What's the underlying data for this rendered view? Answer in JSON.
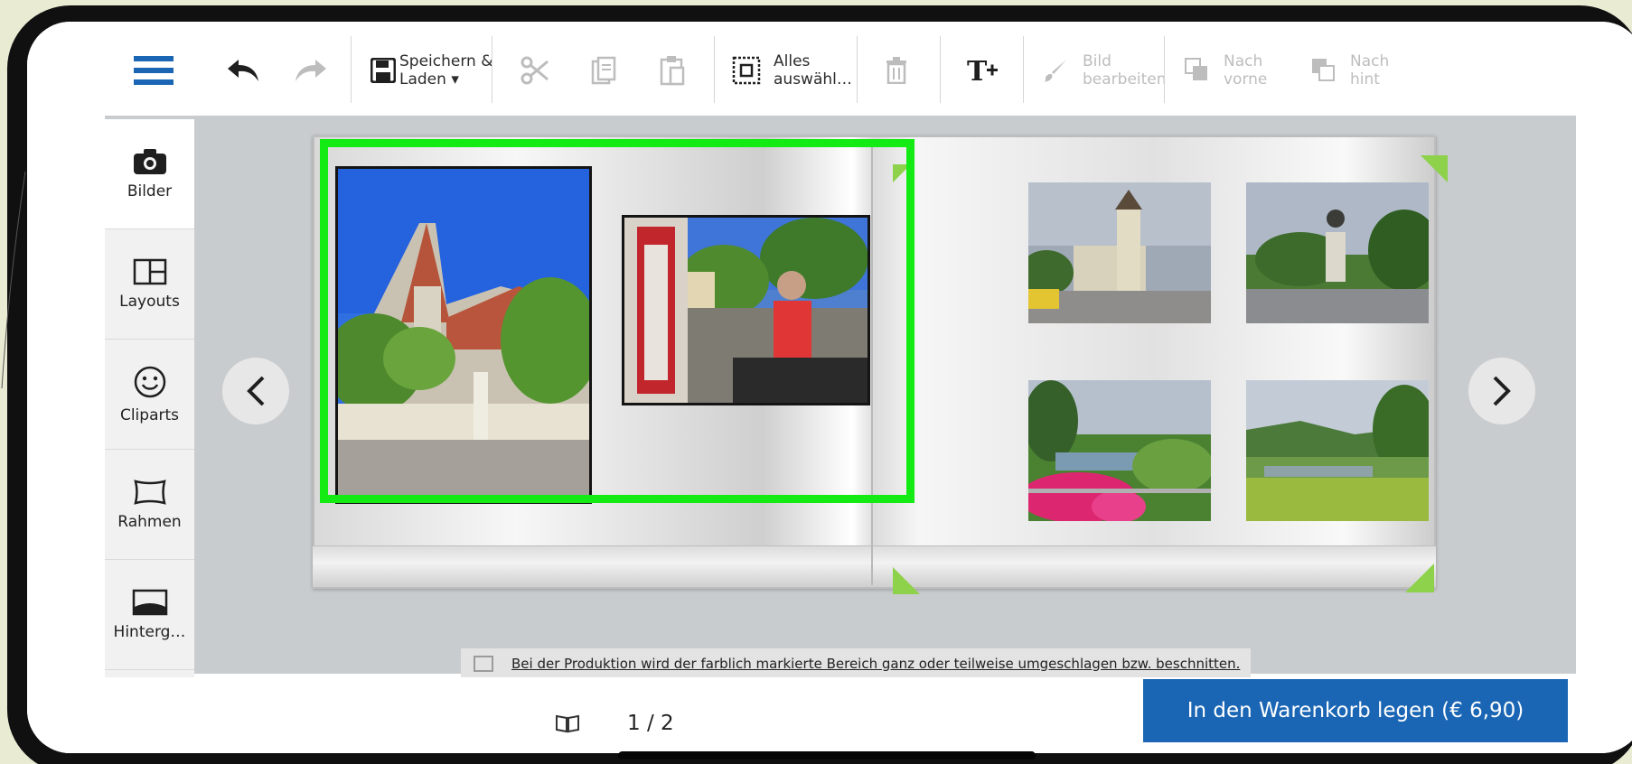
{
  "toolbar": {
    "save_label_line1": "Speichern &",
    "save_label_line2": "Laden ▾",
    "select_all_line1": "Alles",
    "select_all_line2": "auswähl…",
    "edit_image_line1": "Bild",
    "edit_image_line2": "bearbeiten",
    "bring_forward_line1": "Nach",
    "bring_forward_line2": "vorne",
    "send_back_line1": "Nach",
    "send_back_line2": "hint"
  },
  "sidebar": {
    "items": [
      {
        "label": "Bilder",
        "icon": "camera-icon"
      },
      {
        "label": "Layouts",
        "icon": "layout-icon"
      },
      {
        "label": "Cliparts",
        "icon": "smiley-icon"
      },
      {
        "label": "Rahmen",
        "icon": "frame-icon"
      },
      {
        "label": "Hinterg…",
        "icon": "background-icon"
      }
    ]
  },
  "notice": {
    "text": "Bei der Produktion wird der farblich markierte Bereich ganz oder teilweise umgeschlagen bzw. beschnitten."
  },
  "footer": {
    "page_indicator": "1 / 2",
    "cart_button": "In den Warenkorb legen (€ 6,90)"
  },
  "colors": {
    "accent_blue": "#1a66b4",
    "selection_green": "#14ea14",
    "bleed_marker_green": "#8ed14a"
  }
}
